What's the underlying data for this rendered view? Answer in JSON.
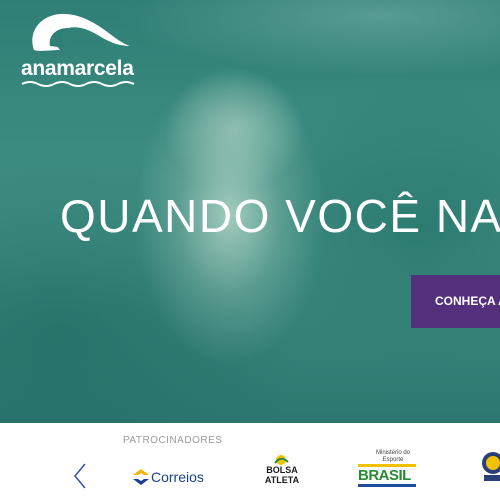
{
  "brand": {
    "name": "anamarcela"
  },
  "hero": {
    "headline": "QUANDO VOCÊ NA",
    "cta_label": "CONHEÇA A"
  },
  "sponsors": {
    "label": "PATROCINADORES",
    "items": [
      {
        "name": "Correios",
        "text": "Correios"
      },
      {
        "name": "Bolsa Atleta",
        "text": "BOLSA ATLETA"
      },
      {
        "name": "Ministério do Esporte",
        "text_small": "Ministério do Esporte",
        "text": "BRASIL"
      },
      {
        "name": "crest-logo"
      }
    ]
  },
  "colors": {
    "hero_teal": "#3c8b80",
    "cta_purple": "#54307c",
    "label_gray": "#9b9b9b"
  }
}
